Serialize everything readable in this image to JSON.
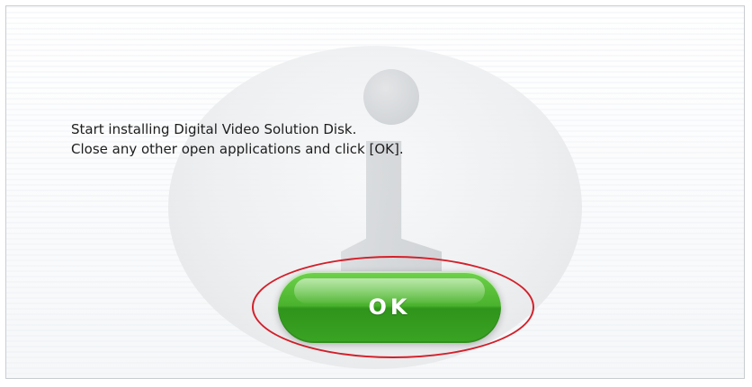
{
  "dialog": {
    "message_lines": [
      "Start installing Digital Video Solution Disk.",
      "Close any other open applications and click [OK]."
    ],
    "ok_label": "OK"
  },
  "icons": {
    "background_info": "info-icon"
  },
  "colors": {
    "ok_button": "#4ab22d",
    "highlight_outline": "#d3202a",
    "text": "#1d1d1d"
  }
}
